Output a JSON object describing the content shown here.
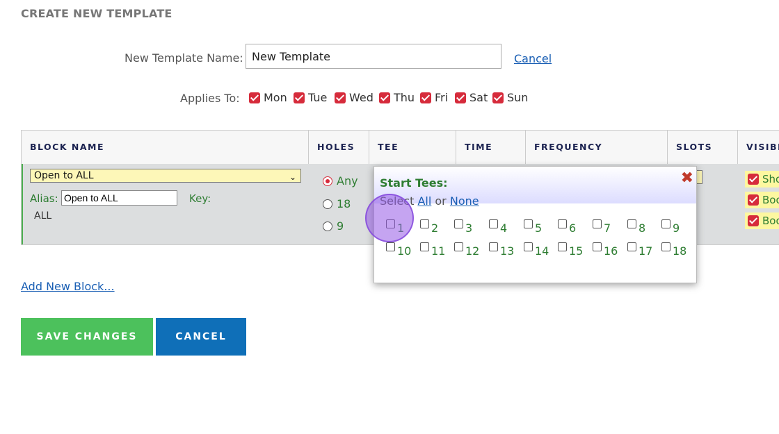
{
  "page": {
    "title": "CREATE NEW TEMPLATE"
  },
  "form": {
    "name_label": "New Template Name:",
    "name_value": "New Template",
    "cancel_link": "Cancel",
    "applies_label": "Applies To:",
    "days": [
      {
        "label": "Mon",
        "checked": true
      },
      {
        "label": "Tue",
        "checked": true
      },
      {
        "label": "Wed",
        "checked": true
      },
      {
        "label": "Thu",
        "checked": true
      },
      {
        "label": "Fri",
        "checked": true
      },
      {
        "label": "Sat",
        "checked": true
      },
      {
        "label": "Sun",
        "checked": true
      }
    ]
  },
  "table": {
    "headers": [
      "BLOCK NAME",
      "HOLES",
      "TEE",
      "TIME",
      "FREQUENCY",
      "SLOTS",
      "VISIBI"
    ],
    "row": {
      "block_select": "Open to ALL",
      "alias_label": "Alias:",
      "alias_value": "Open to ALL",
      "key_label": "Key:",
      "key_value": "ALL",
      "holes": [
        {
          "label": "Any",
          "selected": true
        },
        {
          "label": "18",
          "selected": false
        },
        {
          "label": "9",
          "selected": false
        }
      ],
      "visibility": [
        "Sho",
        "Boo",
        "Boo"
      ]
    }
  },
  "popup": {
    "title": "Start Tees:",
    "select_prefix": "Select",
    "select_all": "All",
    "select_or": "or",
    "select_none": "None",
    "close_icon": "close-x-icon",
    "tees": [
      "1",
      "2",
      "3",
      "4",
      "5",
      "6",
      "7",
      "8",
      "9",
      "10",
      "11",
      "12",
      "13",
      "14",
      "15",
      "16",
      "17",
      "18"
    ]
  },
  "actions": {
    "add_block": "Add New Block...",
    "save": "SAVE CHANGES",
    "cancel": "CANCEL"
  },
  "colors": {
    "accent_green": "#4cc15c",
    "accent_blue": "#0f6fb8",
    "checkbox_red": "#d62b3b",
    "header_navy": "#1b2250"
  }
}
